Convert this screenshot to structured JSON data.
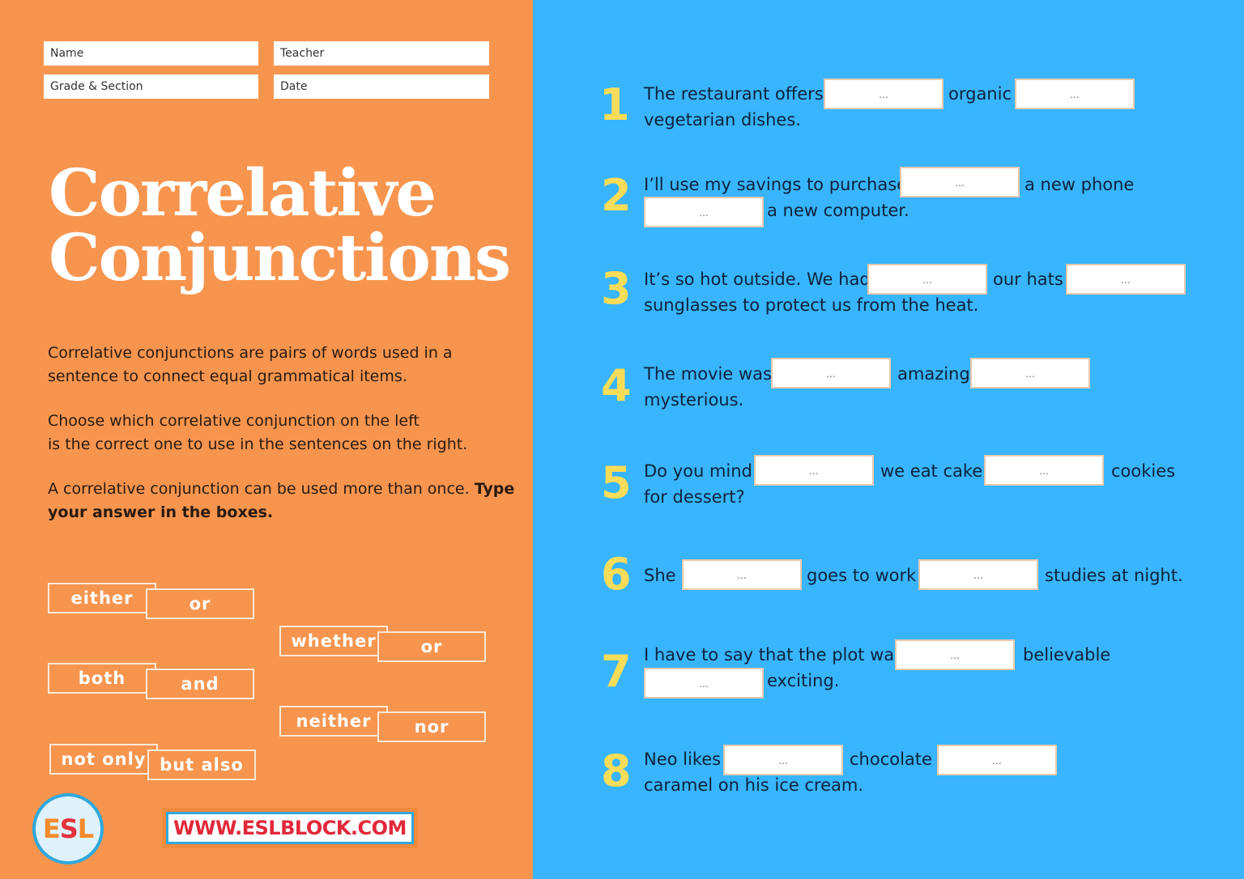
{
  "header_fields": {
    "name": "Name",
    "teacher": "Teacher",
    "grade_section": "Grade & Section",
    "date": "Date"
  },
  "title": {
    "line1": "Correlative",
    "line2": "Conjunctions"
  },
  "description": {
    "p1": "Correlative conjunctions are pairs of words used in a sentence to connect equal grammatical items.",
    "p2_line1": "Choose which correlative conjunction on the left",
    "p2_line2": "is the correct one to use in the sentences on the right.",
    "p3_plain": "A correlative conjunction can be used more than once. ",
    "p3_bold": "Type your answer in the boxes."
  },
  "conjunction_pairs": [
    {
      "first": "either",
      "second": "or"
    },
    {
      "first": "whether",
      "second": "or"
    },
    {
      "first": "both",
      "second": "and"
    },
    {
      "first": "neither",
      "second": "nor"
    },
    {
      "first": "not only",
      "second": "but also"
    }
  ],
  "logo": {
    "e": "E",
    "s": "S",
    "l": "L"
  },
  "website": "WWW.ESLBLOCK.COM",
  "blank_placeholder": "...",
  "questions": [
    {
      "number": "1",
      "parts": [
        "The restaurant offers",
        "organic",
        "vegetarian dishes."
      ]
    },
    {
      "number": "2",
      "parts": [
        "I’ll use my savings to purchase",
        "a new phone",
        "a new computer."
      ]
    },
    {
      "number": "3",
      "parts": [
        "It’s so hot outside. We had",
        "our hats",
        "sunglasses to protect us from the heat."
      ]
    },
    {
      "number": "4",
      "parts": [
        "The movie was",
        "amazing",
        "mysterious."
      ]
    },
    {
      "number": "5",
      "parts": [
        "Do you mind",
        "we eat cake",
        "cookies",
        "for dessert?"
      ]
    },
    {
      "number": "6",
      "parts": [
        "She",
        "goes to work",
        "studies at night."
      ]
    },
    {
      "number": "7",
      "parts": [
        "I have to say that the plot was",
        "believable",
        "exciting."
      ]
    },
    {
      "number": "8",
      "parts": [
        "Neo likes",
        "chocolate",
        "caramel on his ice cream."
      ]
    }
  ],
  "colors": {
    "left_bg": "#f7954f",
    "right_bg": "#38b5fd",
    "number_yellow": "#f9dd59",
    "url_red": "#e2283a"
  }
}
